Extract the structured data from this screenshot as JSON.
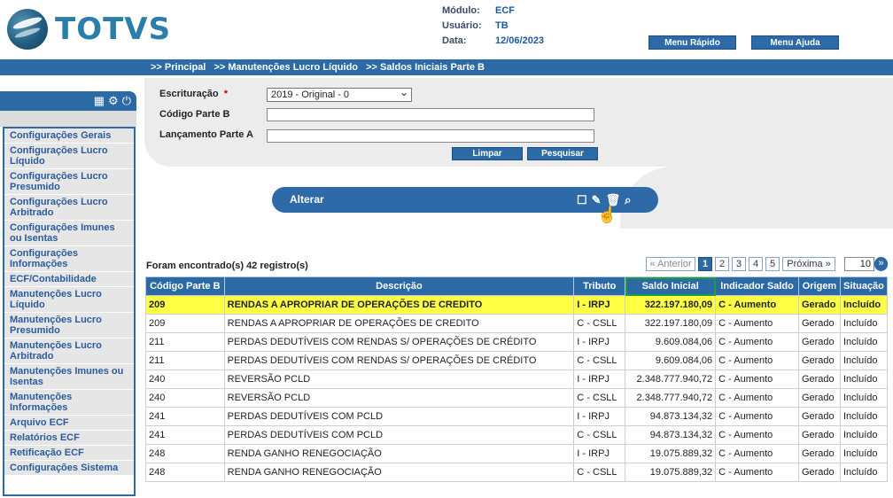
{
  "brand": {
    "name": "TOTVS"
  },
  "info": {
    "modulo_label": "Módulo:",
    "modulo": "ECF",
    "usuario_label": "Usuário:",
    "usuario": "TB",
    "data_label": "Data:",
    "data": "12/06/2023"
  },
  "top_buttons": {
    "menu_rapido": "Menu Rápido",
    "menu_ajuda": "Menu Ajuda"
  },
  "breadcrumb": [
    ">> Principal",
    ">> Manutenções Lucro Líquido",
    ">> Saldos Iniciais Parte B"
  ],
  "sidebar": {
    "tool_icons": [
      "calc-icon",
      "gear-icon",
      "power-icon"
    ],
    "items": [
      "Configurações Gerais",
      "Configurações Lucro Líquido",
      "Configurações Lucro Presumido",
      "Configurações Lucro Arbitrado",
      "Configurações Imunes ou Isentas",
      "Configurações Informações",
      "ECF/Contabilidade",
      "Manutenções Lucro Líquido",
      "Manutenções Lucro Presumido",
      "Manutenções Lucro Arbitrado",
      "Manutenções Imunes ou Isentas",
      "Manutenções Informações",
      "Arquivo ECF",
      "Relatórios ECF",
      "Retificação ECF",
      "Configurações Sistema"
    ]
  },
  "form": {
    "escrituracao_label": "Escrituração",
    "required_mark": "*",
    "escrituracao_value": "2019 - Original - 0",
    "codigo_label": "Código Parte B",
    "lancamento_label": "Lançamento Parte A",
    "limpar": "Limpar",
    "pesquisar": "Pesquisar"
  },
  "action_bar": {
    "label": "Alterar",
    "icons": [
      "checkbox-icon",
      "edit-icon",
      "delete-icon",
      "search-icon"
    ]
  },
  "results": {
    "found": "Foram encontrado(s) 42 registro(s)",
    "anterior": "« Anterior",
    "pages": [
      "1",
      "2",
      "3",
      "4",
      "5"
    ],
    "current_page": "1",
    "proxima": "Próxima »",
    "page_size": "10"
  },
  "table": {
    "columns": [
      "Código Parte B",
      "Descrição",
      "Tributo",
      "Saldo Inicial",
      "Indicador Saldo",
      "Origem",
      "Situação"
    ],
    "rows": [
      [
        "209",
        "RENDAS A APROPRIAR DE OPERAÇÕES DE CREDITO",
        "I - IRPJ",
        "322.197.180,09",
        "C - Aumento",
        "Gerado",
        "Incluído"
      ],
      [
        "209",
        "RENDAS A APROPRIAR DE OPERAÇÕES DE CREDITO",
        "C - CSLL",
        "322.197.180,09",
        "C - Aumento",
        "Gerado",
        "Incluído"
      ],
      [
        "211",
        "PERDAS DEDUTÍVEIS COM RENDAS S/ OPERAÇÕES DE CRÉDITO",
        "I - IRPJ",
        "9.609.084,06",
        "C - Aumento",
        "Gerado",
        "Incluído"
      ],
      [
        "211",
        "PERDAS DEDUTÍVEIS COM RENDAS S/ OPERAÇÕES DE CRÉDITO",
        "C - CSLL",
        "9.609.084,06",
        "C - Aumento",
        "Gerado",
        "Incluído"
      ],
      [
        "240",
        "REVERSÃO PCLD",
        "I - IRPJ",
        "2.348.777.940,72",
        "C - Aumento",
        "Gerado",
        "Incluído"
      ],
      [
        "240",
        "REVERSÃO PCLD",
        "C - CSLL",
        "2.348.777.940,72",
        "C - Aumento",
        "Gerado",
        "Incluído"
      ],
      [
        "241",
        "PERDAS DEDUTÍVEIS COM PCLD",
        "I - IRPJ",
        "94.873.134,32",
        "C - Aumento",
        "Gerado",
        "Incluído"
      ],
      [
        "241",
        "PERDAS DEDUTÍVEIS COM PCLD",
        "C - CSLL",
        "94.873.134,32",
        "C - Aumento",
        "Gerado",
        "Incluído"
      ],
      [
        "248",
        "RENDA GANHO RENEGOCIAÇÃO",
        "I - IRPJ",
        "19.075.889,32",
        "C - Aumento",
        "Gerado",
        "Incluído"
      ],
      [
        "248",
        "RENDA GANHO RENEGOCIAÇÃO",
        "C - CSLL",
        "19.075.889,32",
        "C - Aumento",
        "Gerado",
        "Incluído"
      ]
    ]
  }
}
